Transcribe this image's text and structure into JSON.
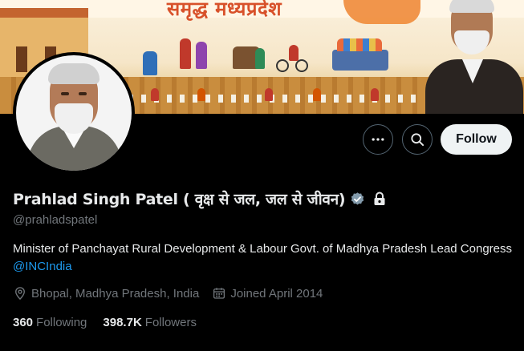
{
  "banner": {
    "title": "समृद्ध मध्यप्रदेश"
  },
  "profile": {
    "name": "Prahlad Singh Patel ( वृक्ष से जल, जल से जीवन)",
    "handle": "@prahladspatel",
    "bio_text": "Minister of Panchayat Rural Development & Labour Govt. of Madhya Pradesh Lead Congress ",
    "bio_link": "@INCIndia",
    "location": "Bhopal, Madhya Pradesh, India",
    "joined": "Joined April 2014",
    "following_count": "360",
    "following_label": "Following",
    "followers_count": "398.7K",
    "followers_label": "Followers",
    "verified_badge_color": "#829aab",
    "link_color": "#1d9bf0"
  },
  "actions": {
    "more_icon": "more-icon",
    "search_icon": "search-icon",
    "follow_label": "Follow"
  }
}
